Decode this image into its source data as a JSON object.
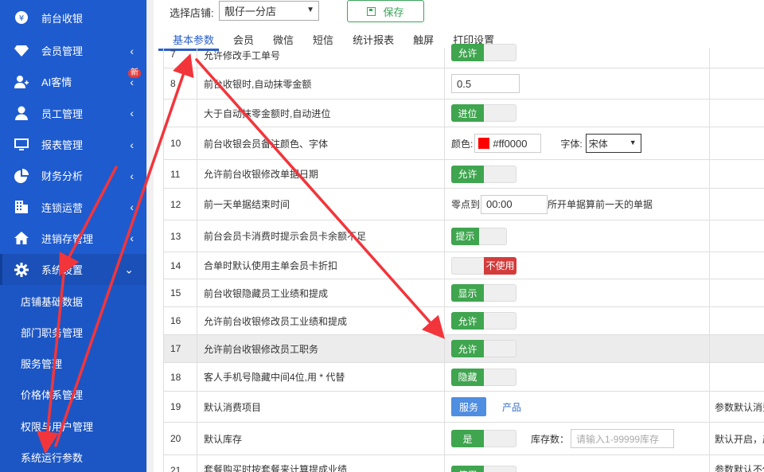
{
  "sidebar": {
    "items": [
      {
        "label": "前台收银",
        "icon": "yen-circle-icon",
        "chev": ""
      },
      {
        "label": "会员管理",
        "icon": "diamond-icon",
        "chev": "‹"
      },
      {
        "label": "AI客情",
        "icon": "user-plus-icon",
        "chev": "‹",
        "badge": "新"
      },
      {
        "label": "员工管理",
        "icon": "user-icon",
        "chev": "‹"
      },
      {
        "label": "报表管理",
        "icon": "monitor-icon",
        "chev": "‹"
      },
      {
        "label": "财务分析",
        "icon": "pie-chart-icon",
        "chev": "‹"
      },
      {
        "label": "连锁运营",
        "icon": "building-icon",
        "chev": "‹"
      },
      {
        "label": "进销存管理",
        "icon": "home-icon",
        "chev": "‹"
      },
      {
        "label": "系统设置",
        "icon": "gear-icon",
        "chev": "⌄"
      }
    ],
    "subitems": [
      "店铺基础数据",
      "部门职务管理",
      "服务管理",
      "价格体系管理",
      "权限与用户管理",
      "系统运行参数"
    ]
  },
  "topbar": {
    "store_label": "选择店铺:",
    "store_value": "靓仔一分店",
    "save_label": "保存"
  },
  "tabs": [
    "基本参数",
    "会员",
    "微信",
    "短信",
    "统计报表",
    "触屏",
    "打印设置"
  ],
  "rows": [
    {
      "num": "7",
      "label": "允许修改手工单号",
      "toggle": "允许"
    },
    {
      "num": "8",
      "label": "前台收银时,自动抹零金额",
      "input": "0.5"
    },
    {
      "num": "",
      "label": "大于自动抹零金额时,自动进位",
      "toggle": "进位"
    },
    {
      "num": "10",
      "label": "前台收银会员备注颜色、字体",
      "color_label": "颜色:",
      "color_value": "#ff0000",
      "font_label": "字体:",
      "font_value": "宋体"
    },
    {
      "num": "11",
      "label": "允许前台收银修改单据日期",
      "toggle": "允许"
    },
    {
      "num": "12",
      "label": "前一天单据结束时间",
      "time_prefix": "零点到",
      "time_value": "00:00",
      "time_suffix": "所开单据算前一天的单据"
    },
    {
      "num": "13",
      "label": "前台会员卡消费时提示会员卡余额不足",
      "toggle": "提示"
    },
    {
      "num": "14",
      "label": "合单时默认使用主单会员卡折扣",
      "toggle_off": "不使用"
    },
    {
      "num": "15",
      "label": "前台收银隐藏员工业绩和提成",
      "toggle": "显示"
    },
    {
      "num": "16",
      "label": "允许前台收银修改员工业绩和提成",
      "toggle": "允许"
    },
    {
      "num": "17",
      "label": "允许前台收银修改员工职务",
      "toggle": "允许"
    },
    {
      "num": "18",
      "label": "客人手机号隐藏中间4位,用 * 代替",
      "toggle": "隐藏"
    },
    {
      "num": "19",
      "label": "默认消费项目",
      "btn": "服务",
      "link": "产品",
      "note": "参数默认消费"
    },
    {
      "num": "20",
      "label": "默认库存",
      "toggle": "是",
      "stock_label": "库存数：",
      "stock_placeholder": "请输入1-99999库存",
      "note": "默认开启，产"
    },
    {
      "num": "21",
      "label": "套餐购买时按套餐来计算提成业绩",
      "toggle": "使用",
      "note": "参数默认不使"
    }
  ],
  "colors": {
    "sidebar": "#1e5bcf",
    "toggle_on": "#3fa54f",
    "toggle_off": "#d43c3c",
    "tab_active": "#2a5fc9",
    "arrow": "#f2353b"
  }
}
